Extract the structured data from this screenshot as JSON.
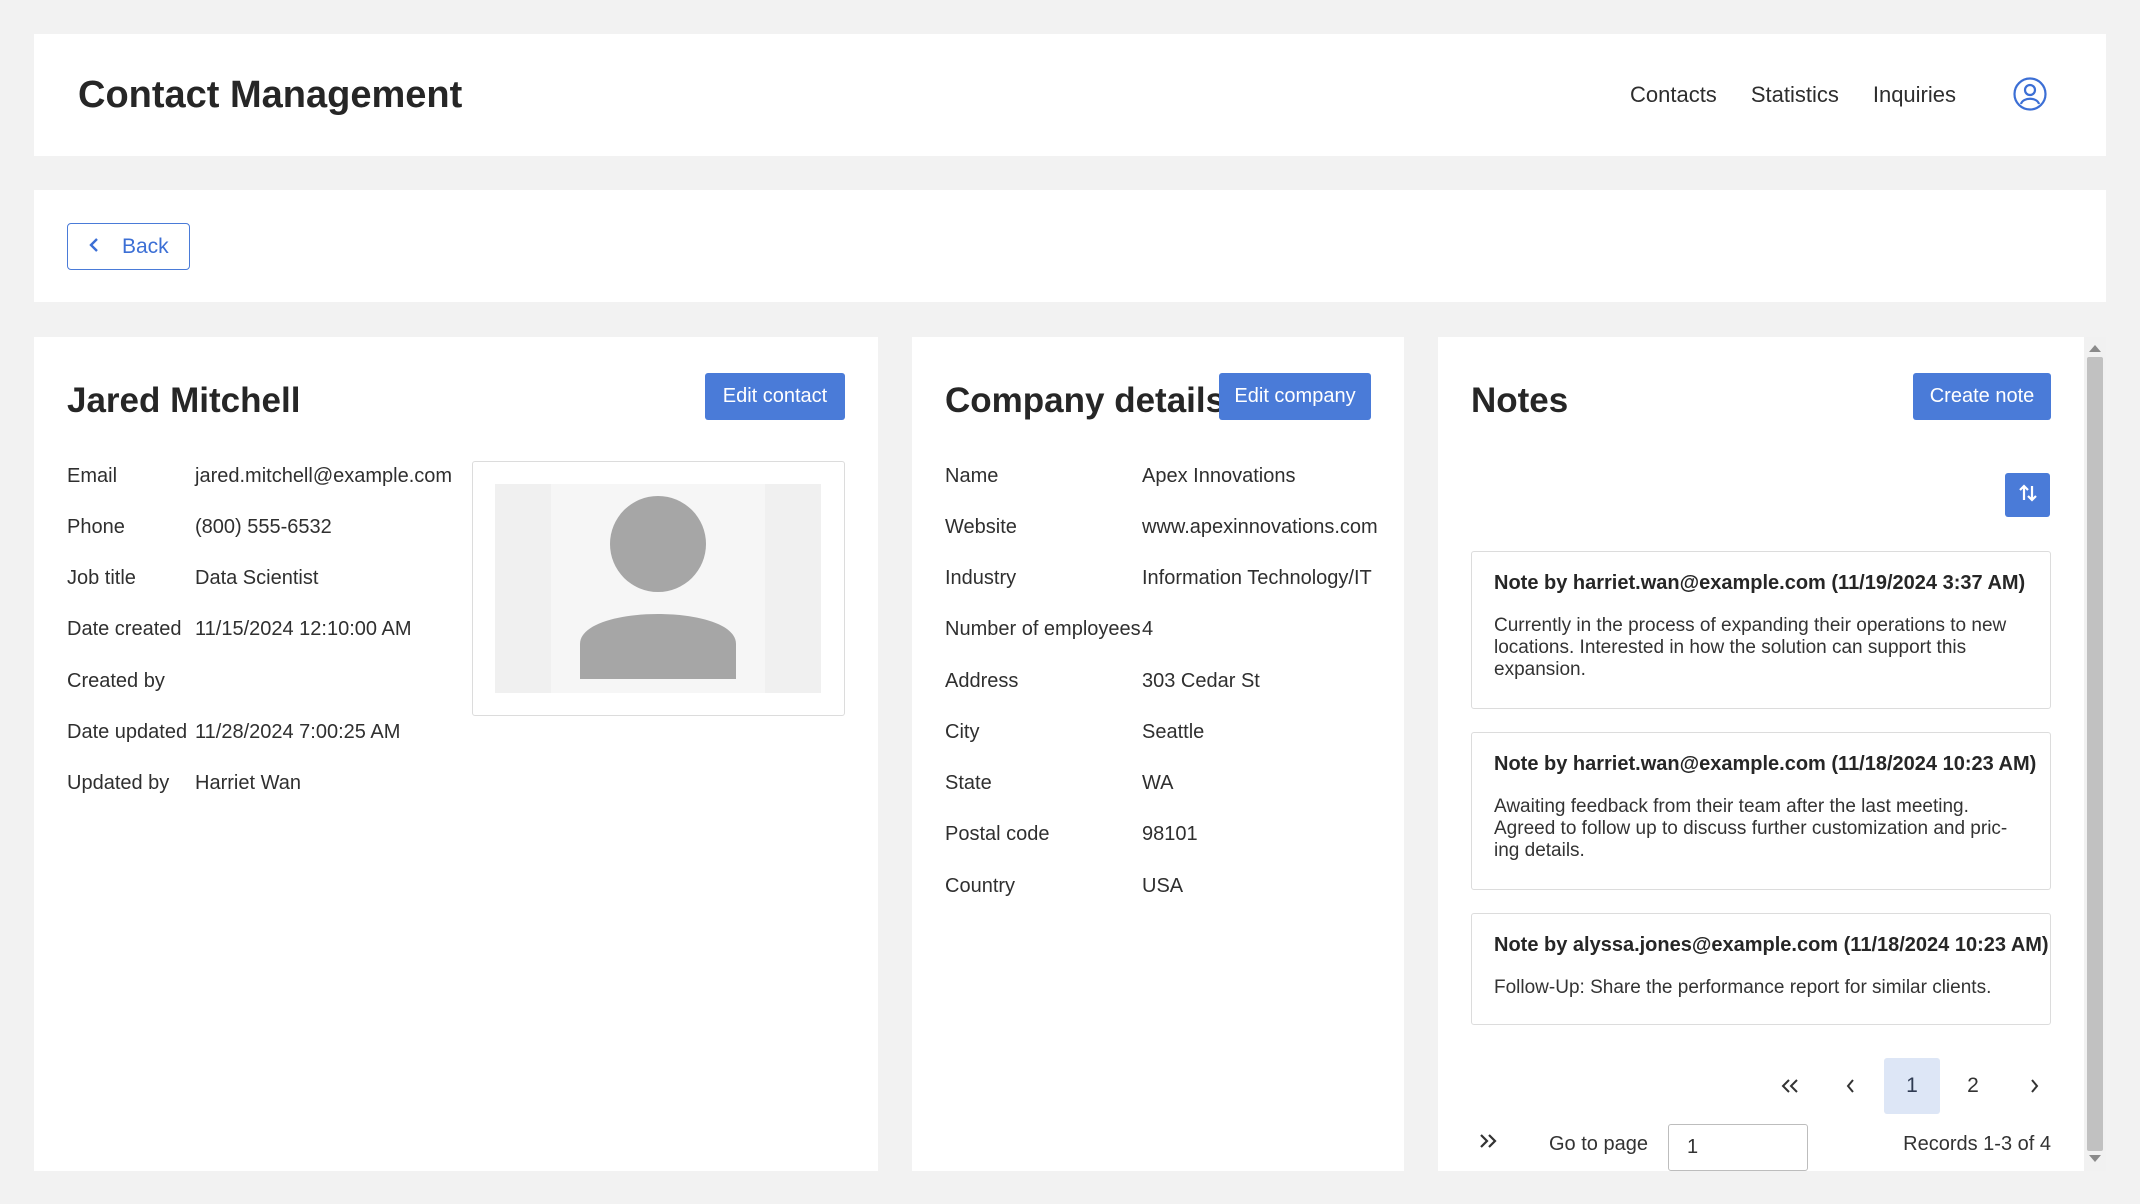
{
  "header": {
    "title": "Contact Management",
    "nav": [
      "Contacts",
      "Statistics",
      "Inquiries"
    ],
    "user_icon": "user-circle-icon"
  },
  "backbar": {
    "back_label": "Back",
    "icon": "chevron-left-icon"
  },
  "contact": {
    "name": "Jared Mitchell",
    "edit_label": "Edit contact",
    "fields": [
      {
        "label": "Email",
        "value": "jared.mitchell@example.com"
      },
      {
        "label": "Phone",
        "value": "(800) 555-6532"
      },
      {
        "label": "Job title",
        "value": "Data Scientist"
      },
      {
        "label": "Date created",
        "value": "11/15/2024 12:10:00 AM"
      },
      {
        "label": "Created by",
        "value": ""
      },
      {
        "label": "Date updated",
        "value": "11/28/2024 7:00:25 AM"
      },
      {
        "label": "Updated by",
        "value": "Harriet Wan"
      }
    ],
    "avatar_icon": "person-placeholder-icon"
  },
  "company": {
    "title": "Company details",
    "edit_label": "Edit company",
    "fields": [
      {
        "label": "Name",
        "value": "Apex Innovations"
      },
      {
        "label": "Website",
        "value": "www.apexinnovations.com"
      },
      {
        "label": "Industry",
        "value": "Information Technology/IT"
      },
      {
        "label": "Number of employees",
        "value": "4"
      },
      {
        "label": "Address",
        "value": "303 Cedar St"
      },
      {
        "label": "City",
        "value": "Seattle"
      },
      {
        "label": "State",
        "value": "WA"
      },
      {
        "label": "Postal code",
        "value": "98101"
      },
      {
        "label": "Country",
        "value": "USA"
      }
    ]
  },
  "notes": {
    "title": "Notes",
    "create_label": "Create note",
    "sort_icon": "sort-arrows-icon",
    "items": [
      {
        "heading": "Note by harriet.wan@example.com (11/19/2024 3:37 AM)",
        "lines": [
          "Currently in the process of expanding their operations to new",
          "locations. Interested in how the solution can support this",
          "expansion."
        ]
      },
      {
        "heading": "Note by harriet.wan@example.com (11/18/2024 10:23 AM)",
        "lines": [
          "Awaiting feedback from their team after the last meeting.",
          "Agreed to follow up to discuss further customization and pric-",
          "ing details."
        ]
      },
      {
        "heading": "Note by alyssa.jones@example.com (11/18/2024 10:23 AM)",
        "lines": [
          "Follow-Up: Share the performance report for similar clients."
        ]
      }
    ],
    "pagination": {
      "first": "«",
      "prev": "‹",
      "pages": [
        "1",
        "2"
      ],
      "current": "1",
      "next": "›",
      "last": "»",
      "goto_label": "Go to page",
      "goto_value": "1",
      "records": "Records 1-3 of 4"
    }
  }
}
